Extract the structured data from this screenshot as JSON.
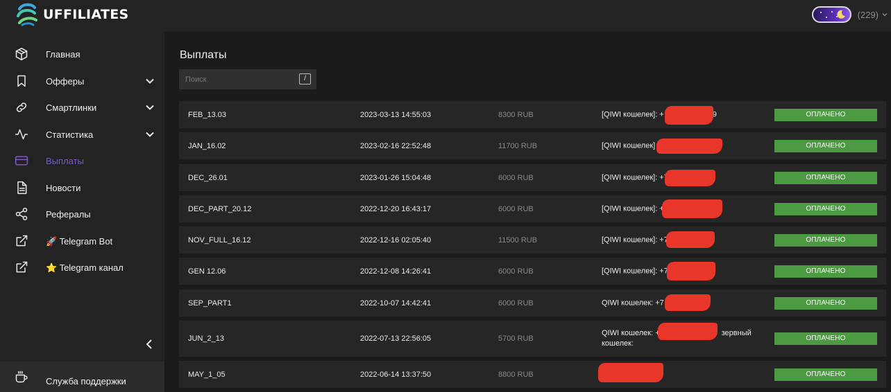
{
  "header": {
    "logo_text": "UFFILIATES",
    "balance_count": "(229)",
    "colors": {
      "background": "#232323",
      "toggle": "#5b2fb8"
    }
  },
  "sidebar": {
    "items": [
      {
        "label": "Главная",
        "icon": "cube-icon",
        "has_chevron": false,
        "active": false
      },
      {
        "label": "Офферы",
        "icon": "bookmark-icon",
        "has_chevron": true,
        "active": false
      },
      {
        "label": "Смартлинки",
        "icon": "link-icon",
        "has_chevron": true,
        "active": false
      },
      {
        "label": "Статистика",
        "icon": "activity-icon",
        "has_chevron": true,
        "active": false
      },
      {
        "label": "Выплаты",
        "icon": "credit-card-icon",
        "has_chevron": false,
        "active": true
      },
      {
        "label": "Новости",
        "icon": "document-icon",
        "has_chevron": false,
        "active": false
      },
      {
        "label": "Рефералы",
        "icon": "share-icon",
        "has_chevron": false,
        "active": false
      },
      {
        "label": "🚀 Telegram Bot",
        "icon": "external-link-icon",
        "has_chevron": false,
        "active": false
      },
      {
        "label": "⭐ Telegram канал",
        "icon": "external-link-icon",
        "has_chevron": false,
        "active": false
      }
    ],
    "support_label": "Служба поддержки",
    "active_color": "#7b5cc4"
  },
  "main": {
    "title": "Выплаты",
    "search": {
      "placeholder": "Поиск",
      "shortcut": "/"
    },
    "payouts": [
      {
        "name": "FEB_13.03",
        "date": "2023-03-13 14:55:03",
        "amount": "8300 RUB",
        "wallet": "[QIWI кошелек]: +",
        "wallet_suffix": "9",
        "status": "ОПЛАЧЕНО"
      },
      {
        "name": "JAN_16.02",
        "date": "2023-02-16 22:52:48",
        "amount": "11700 RUB",
        "wallet": "[QIWI кошелек]",
        "wallet_suffix": "",
        "status": "ОПЛАЧЕНО"
      },
      {
        "name": "DEC_26.01",
        "date": "2023-01-26 15:04:48",
        "amount": "6000 RUB",
        "wallet": "[QIWI кошелек]: +7",
        "wallet_suffix": "",
        "status": "ОПЛАЧЕНО"
      },
      {
        "name": "DEC_PART_20.12",
        "date": "2022-12-20 16:43:17",
        "amount": "6000 RUB",
        "wallet": "[QIWI кошелек]: +",
        "wallet_suffix": "",
        "status": "ОПЛАЧЕНО"
      },
      {
        "name": "NOV_FULL_16.12",
        "date": "2022-12-16 02:05:40",
        "amount": "11500 RUB",
        "wallet": "[QIWI кошелек]: +7",
        "wallet_suffix": "",
        "status": "ОПЛАЧЕНО"
      },
      {
        "name": "GEN 12.06",
        "date": "2022-12-08 14:26:41",
        "amount": "6000 RUB",
        "wallet": "[QIWI кошелек]: +7",
        "wallet_suffix": "",
        "status": "ОПЛАЧЕНО"
      },
      {
        "name": "SEP_PART1",
        "date": "2022-10-07 14:42:41",
        "amount": "6000 RUB",
        "wallet": "QIWI кошелек: +7",
        "wallet_suffix": "",
        "status": "ОПЛАЧЕНО"
      },
      {
        "name": "JUN_2_13",
        "date": "2022-07-13 22:56:05",
        "amount": "5700 RUB",
        "wallet": "QIWI кошелек: +",
        "wallet_suffix": "зервный",
        "wallet_line2": "кошелек:",
        "status": "ОПЛАЧЕНО"
      },
      {
        "name": "MAY_1_05",
        "date": "2022-06-14 13:37:50",
        "amount": "8800 RUB",
        "wallet": "",
        "wallet_suffix": "",
        "status": "ОПЛАЧЕНО"
      }
    ],
    "colors": {
      "status_paid": "#4c9a42",
      "redaction": "#e8362a",
      "row_background": "#262626"
    }
  }
}
